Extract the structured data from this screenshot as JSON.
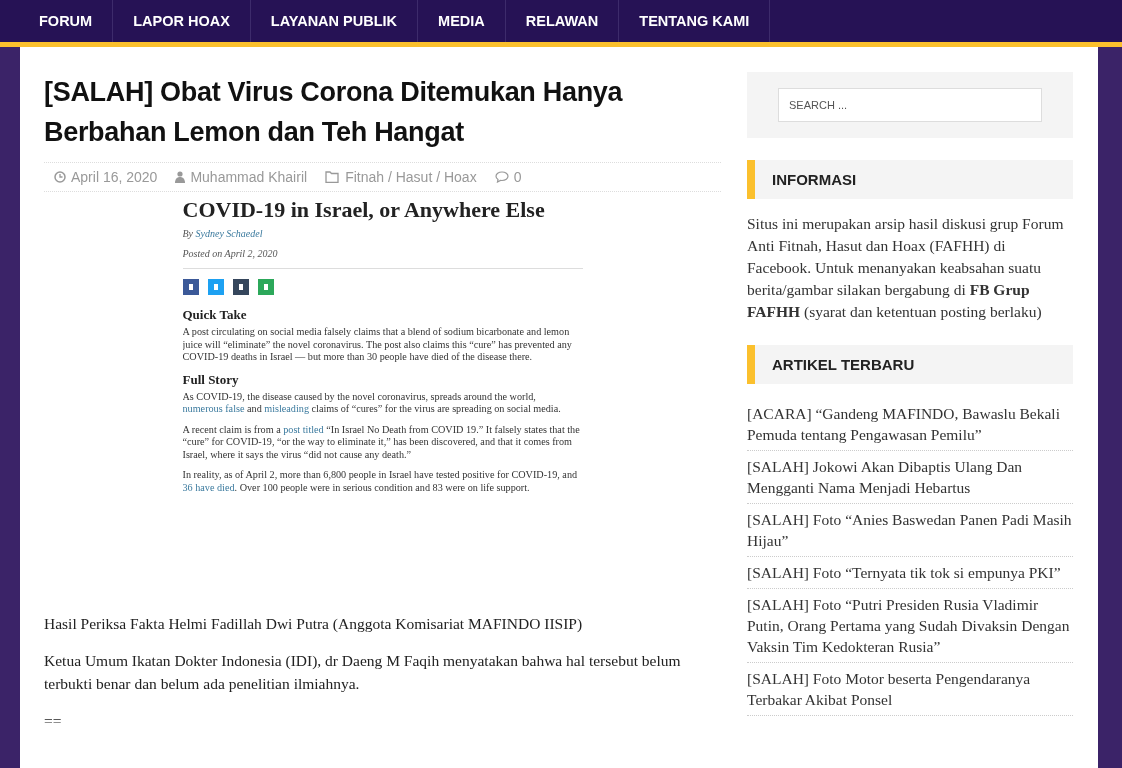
{
  "nav": {
    "items": [
      {
        "label": "FORUM"
      },
      {
        "label": "LAPOR HOAX"
      },
      {
        "label": "LAYANAN PUBLIK"
      },
      {
        "label": "MEDIA"
      },
      {
        "label": "RELAWAN"
      },
      {
        "label": "TENTANG KAMI"
      }
    ]
  },
  "article": {
    "title": "[SALAH] Obat Virus Corona Ditemukan Hanya Berbahan Lemon dan Teh Hangat",
    "meta": {
      "date": "April 16, 2020",
      "author": "Muhammad Khairil",
      "category": "Fitnah / Hasut / Hoax",
      "comments": "0"
    },
    "embedded_screenshot": {
      "headline": "COVID-19 in Israel, or Anywhere Else",
      "byline_prefix": "By",
      "byline_author": "Sydney Schaedel",
      "posted": "Posted on April 2, 2020",
      "sections": [
        {
          "heading": "Quick Take",
          "paragraphs": [
            [
              {
                "text": "A post circulating on social media falsely claims that a blend of sodium bicarbonate and lemon juice will “eliminate” the novel coronavirus. The post also claims this “cure” has prevented any COVID-19 deaths in Israel — but more than 30 people have died of the disease there.",
                "link": false
              }
            ]
          ]
        },
        {
          "heading": "Full Story",
          "paragraphs": [
            [
              {
                "text": "As COVID-19, the disease caused by the novel coronavirus, spreads around the world, ",
                "link": false
              },
              {
                "text": "numerous false",
                "link": true
              },
              {
                "text": " and ",
                "link": false
              },
              {
                "text": "misleading",
                "link": true
              },
              {
                "text": " claims of “cures” for the virus are spreading on social media.",
                "link": false
              }
            ],
            [
              {
                "text": "A recent claim is from a ",
                "link": false
              },
              {
                "text": "post titled",
                "link": true
              },
              {
                "text": " “In Israel No Death from COVID 19.”  It falsely states that the “cure” for COVID-19, “or the way to eliminate it,” has been discovered, and that it comes from Israel, where it says the virus “did not cause any death.”",
                "link": false
              }
            ],
            [
              {
                "text": "In reality, as of April 2, more than 6,800 people in Israel have tested positive for COVID-19, and ",
                "link": false
              },
              {
                "text": "36 have died",
                "link": true
              },
              {
                "text": ". Over 100 people were in serious condition and 83 were on life support.",
                "link": false
              }
            ]
          ]
        }
      ]
    },
    "body": [
      "Hasil Periksa Fakta Helmi Fadillah Dwi Putra (Anggota Komisariat MAFINDO IISIP)",
      "Ketua Umum Ikatan Dokter Indonesia (IDI), dr Daeng M Faqih menyatakan bahwa hal tersebut belum terbukti benar dan belum ada penelitian ilmiahnya.",
      "=="
    ]
  },
  "sidebar": {
    "search": {
      "placeholder": "SEARCH ..."
    },
    "informasi": {
      "title": "INFORMASI",
      "text": "Situs ini merupakan arsip hasil diskusi grup Forum Anti Fitnah, Hasut dan Hoax (FAFHH) di Facebook. Untuk menanyakan keabsahan suatu berita/gambar silakan bergabung di **FB Grup FAFHH** (syarat dan ketentuan posting berlaku)"
    },
    "artikel_terbaru": {
      "title": "ARTIKEL TERBARU",
      "items": [
        "[ACARA] “Gandeng MAFINDO, Bawaslu Bekali Pemuda tentang Pengawasan Pemilu”",
        "[SALAH] Jokowi Akan Dibaptis Ulang Dan Mengganti Nama Menjadi Hebartus",
        "[SALAH] Foto “Anies Baswedan Panen Padi Masih Hijau”",
        "[SALAH] Foto “Ternyata tik tok si empunya PKI”",
        "[SALAH] Foto “Putri Presiden Rusia Vladimir Putin, Orang Pertama yang Sudah Divaksin Dengan Vaksin Tim Kedokteran Rusia”",
        "[SALAH] Foto Motor beserta Pengendaranya Terbakar Akibat Ponsel"
      ]
    }
  }
}
